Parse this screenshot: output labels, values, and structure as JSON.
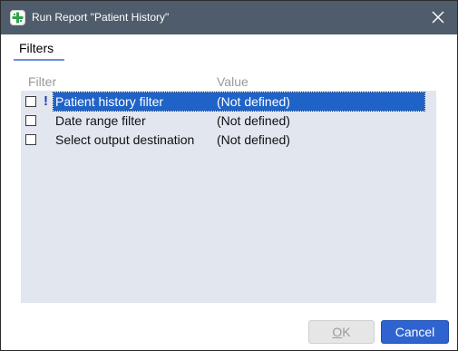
{
  "window": {
    "title": "Run Report \"Patient History\"",
    "icon": "report-app-icon",
    "close_icon": "close-icon"
  },
  "tabs": [
    {
      "label": "Filters"
    }
  ],
  "grid": {
    "columns": [
      "Filter",
      "Value"
    ],
    "rows": [
      {
        "checked": false,
        "flag": "!",
        "filter": "Patient history filter",
        "value": "(Not defined)",
        "selected": true
      },
      {
        "checked": false,
        "flag": "",
        "filter": "Date range filter",
        "value": "(Not defined)",
        "selected": false
      },
      {
        "checked": false,
        "flag": "",
        "filter": "Select output destination",
        "value": "(Not defined)",
        "selected": false
      }
    ]
  },
  "buttons": {
    "ok": "OK",
    "ok_enabled": false,
    "cancel": "Cancel"
  },
  "colors": {
    "titlebar": "#4f5c6b",
    "selection": "#1f63c8",
    "grid_bg": "#e1e6ef",
    "primary_button": "#2f64d0"
  }
}
